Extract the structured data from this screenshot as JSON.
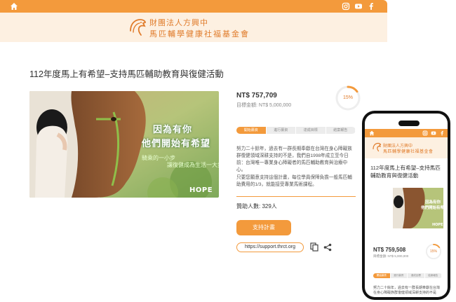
{
  "org": {
    "line1": "財團法人方興中",
    "line2": "馬匹輔學健康社福基金會"
  },
  "project": {
    "title": "112年度馬上有希望–支持馬匹輔助教育與復健活動",
    "amount": "NT$ 757,709",
    "target": "目標金額: NT$ 5,000,000",
    "progress_label": "15%",
    "progress": 0.15,
    "steps": [
      "開始募資",
      "進行募資",
      "達成目標",
      "結案報告"
    ],
    "description": [
      "努力二十餘年，過去有一群長期奉獻在台灣在身心障礙族群復健領域深耕支持的不是，我們自1998年成立至今日前：台灣唯一專業身心障礙者的馬匹輔助教育與治療中心。",
      "只要您願意支持這個計畫，每位學員保障負擔一般馬匹輔助費用的1/3，就能接受專業馬術課程。"
    ],
    "donors": "贊助人數: 329人",
    "support_button": "支持計畫",
    "share_url": "https://support.thrct.org"
  },
  "hero": {
    "headline_1": "因為有你",
    "headline_2": "他們開始有希望",
    "sub_1": "騎乘的一小步",
    "sub_2": "讓復健成為生活一大步",
    "logo": "HOPE"
  },
  "mobile": {
    "org_line1": "財團法人方興中",
    "org_line2": "馬匹輔學健康社福基金會",
    "title": "112年度馬上有希望–支持馬匹輔助教育與復健活動",
    "amount": "NT$ 759,508",
    "target": "目標金額: NT$ 5,000,000",
    "progress_label": "15%",
    "steps": [
      "開始募資",
      "進行募資",
      "達成目標",
      "結案報告"
    ],
    "description": "努力二十餘年，過去有一群長期奉獻在台灣在身心障礙族群復健領域深耕支持的不是"
  },
  "colors": {
    "accent": "#f39a3c",
    "header_bg": "#fdf0e1",
    "brand_text": "#e07b2a"
  },
  "icons": [
    "home-icon",
    "instagram-icon",
    "youtube-icon",
    "facebook-icon",
    "copy-icon",
    "share-icon",
    "horse-logo-icon"
  ]
}
